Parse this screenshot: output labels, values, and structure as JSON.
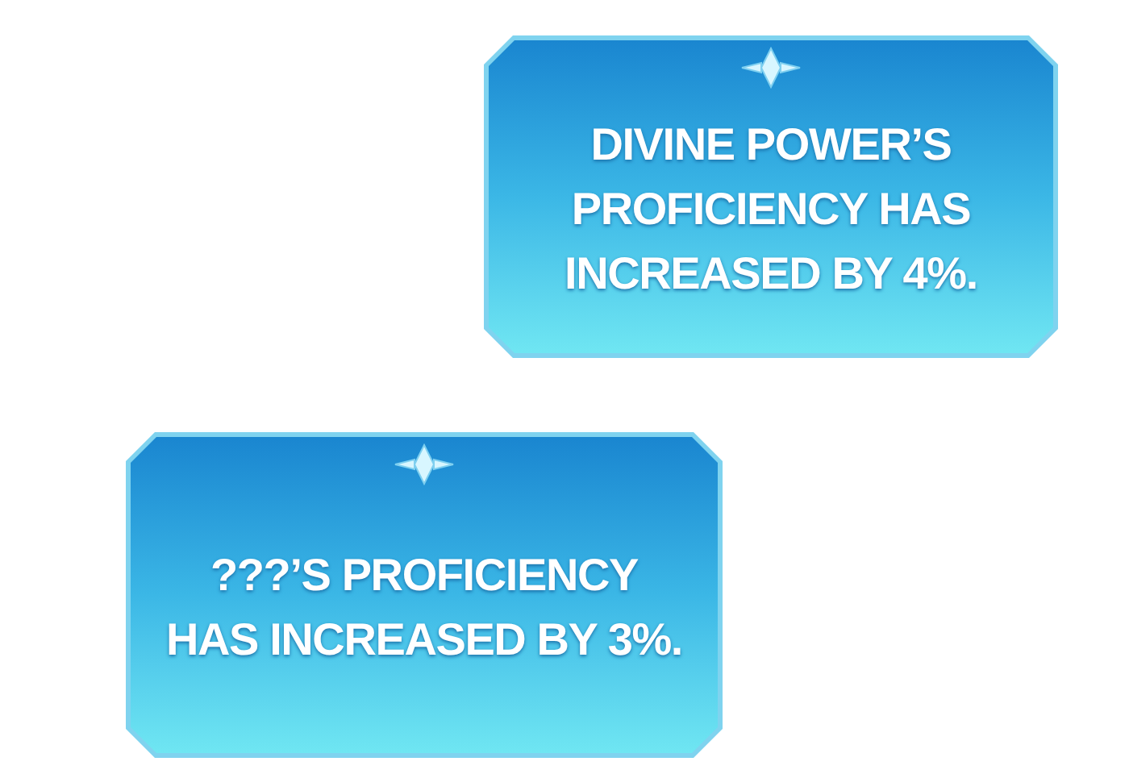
{
  "notifications": [
    {
      "lines": [
        "DIVINE POWER’S",
        "PROFICIENCY HAS",
        "INCREASED BY 4%."
      ]
    },
    {
      "lines": [
        "???’S PROFICIENCY",
        "HAS INCREASED BY 3%."
      ]
    }
  ]
}
